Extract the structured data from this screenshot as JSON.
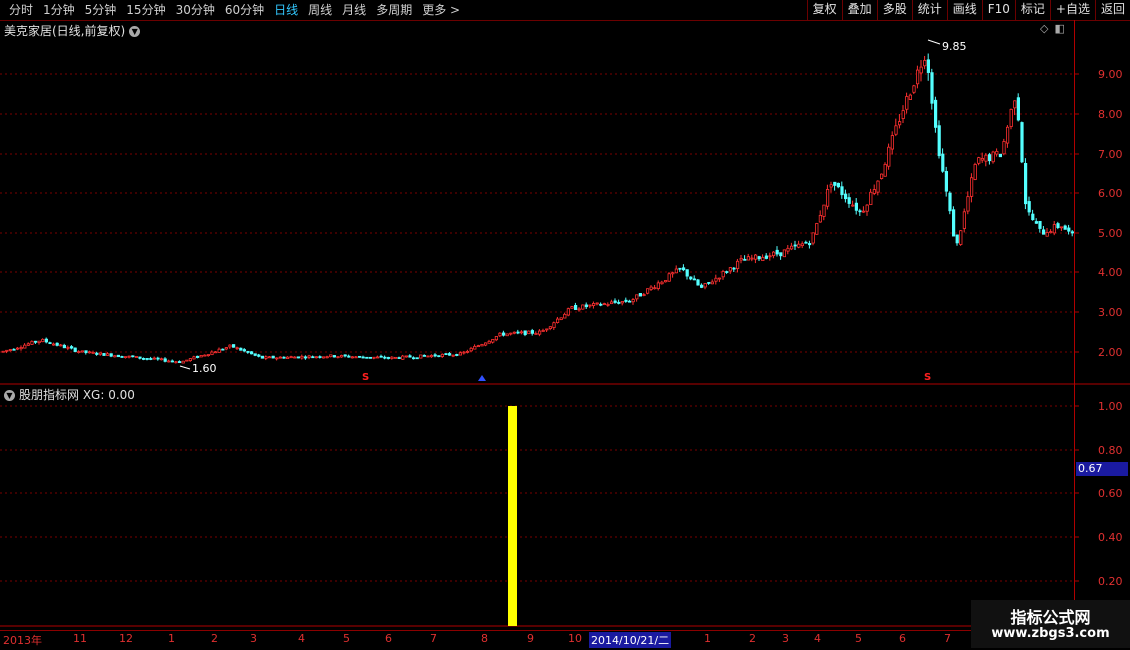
{
  "toolbar": {
    "periods": [
      "分时",
      "1分钟",
      "5分钟",
      "15分钟",
      "30分钟",
      "60分钟",
      "日线",
      "周线",
      "月线",
      "多周期",
      "更多 >"
    ],
    "active_index": 6,
    "right_buttons": [
      "复权",
      "叠加",
      "多股",
      "统计",
      "画线",
      "F10",
      "标记",
      "+自选",
      "返回"
    ]
  },
  "main_chart": {
    "title": "美克家居(日线,前复权)",
    "y_ticks": [
      "9.00",
      "8.00",
      "7.00",
      "6.00",
      "5.00",
      "4.00",
      "3.00",
      "2.00"
    ],
    "high_label": "9.85",
    "low_label": "1.60",
    "signal_markers": [
      "S",
      "B",
      "S"
    ]
  },
  "indicator": {
    "title": "股朋指标网 XG: 0.00",
    "y_ticks": [
      "1.00",
      "0.80",
      "0.60",
      "0.40",
      "0.20"
    ],
    "current_value": "0.67",
    "signal_value": 1.0
  },
  "date_axis": {
    "labels": [
      "2013年",
      "11",
      "12",
      "1",
      "2",
      "3",
      "4",
      "5",
      "6",
      "7",
      "8",
      "9",
      "10",
      "2014/10/21/二",
      "1",
      "2",
      "3",
      "4",
      "5",
      "6",
      "7"
    ]
  },
  "watermark": {
    "line1": "指标公式网",
    "line2": "www.zbgs3.com"
  },
  "chart_data": {
    "type": "candlestick",
    "title": "美克家居(日线,前复权)",
    "ylim": [
      1.4,
      10.2
    ],
    "price_path": [
      [
        0,
        2.0
      ],
      [
        40,
        2.3
      ],
      [
        80,
        2.0
      ],
      [
        180,
        1.75
      ],
      [
        230,
        2.15
      ],
      [
        260,
        1.85
      ],
      [
        330,
        1.9
      ],
      [
        390,
        1.85
      ],
      [
        460,
        1.95
      ],
      [
        500,
        2.45
      ],
      [
        540,
        2.5
      ],
      [
        570,
        3.1
      ],
      [
        630,
        3.3
      ],
      [
        680,
        4.1
      ],
      [
        700,
        3.6
      ],
      [
        740,
        4.3
      ],
      [
        780,
        4.5
      ],
      [
        810,
        4.8
      ],
      [
        830,
        6.3
      ],
      [
        860,
        5.5
      ],
      [
        880,
        6.5
      ],
      [
        900,
        8.0
      ],
      [
        925,
        9.6
      ],
      [
        935,
        7.5
      ],
      [
        955,
        4.6
      ],
      [
        975,
        6.8
      ],
      [
        1000,
        7.0
      ],
      [
        1015,
        8.6
      ],
      [
        1025,
        5.6
      ],
      [
        1040,
        5.0
      ],
      [
        1060,
        5.2
      ],
      [
        1072,
        4.9
      ]
    ],
    "high": 9.85,
    "low": 1.6,
    "indicator_bars": [
      {
        "x": 512,
        "value": 1.0
      }
    ]
  }
}
